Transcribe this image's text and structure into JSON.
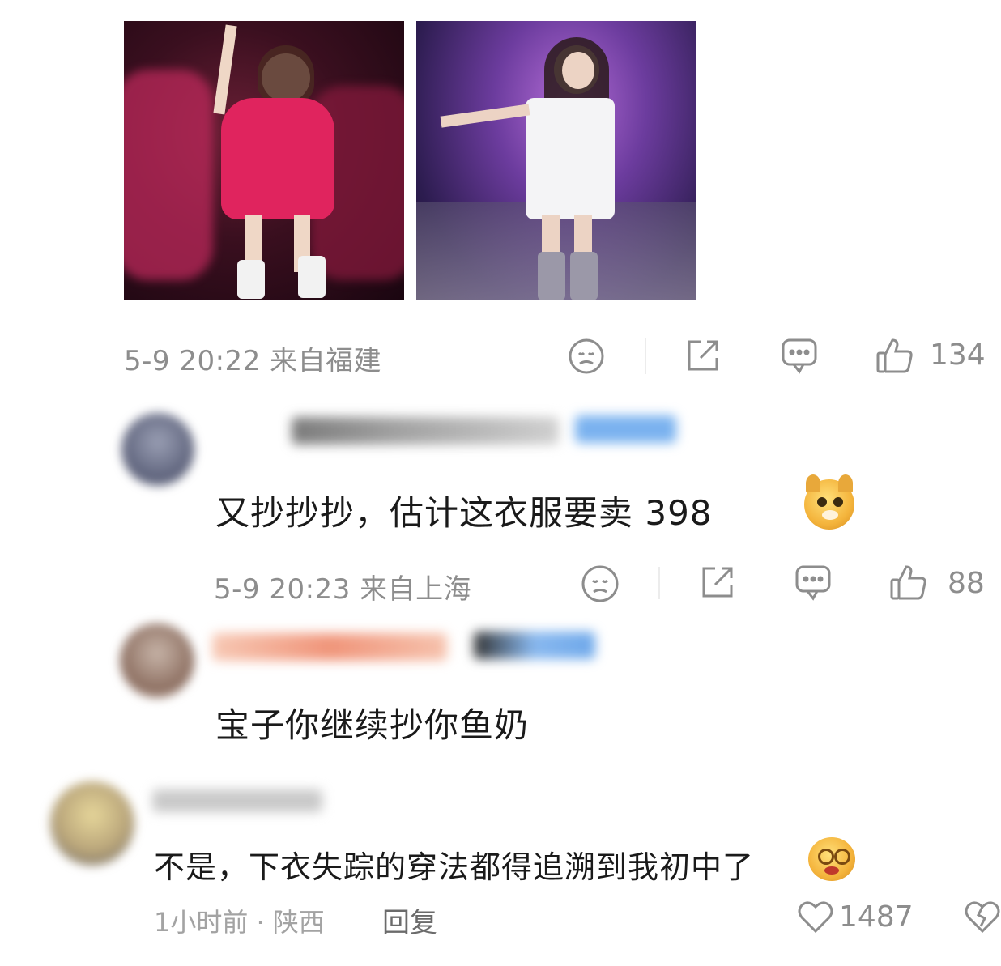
{
  "post": {
    "images": [
      {
        "name": "concert-photo-pink-shirt"
      },
      {
        "name": "concert-photo-white-shirt"
      }
    ],
    "meta": "5-9 20:22 来自福建",
    "like_count": "134"
  },
  "comments": [
    {
      "text": "又抄抄抄，估计这衣服要卖 398",
      "emoji": "doge-emoji",
      "meta": "5-9 20:23 来自上海",
      "like_count": "88"
    },
    {
      "text": "宝子你继续抄你鱼奶"
    },
    {
      "text": "不是，下衣失踪的穿法都得追溯到我初中了",
      "emoji": "dizzy-face-emoji",
      "time": "1小时前",
      "separator": "·",
      "location": "陕西",
      "reply_label": "回复",
      "like_count": "1487"
    }
  ],
  "colors": {
    "meta_gray": "#8d8d8d",
    "text_dark": "#1a1a1a",
    "accent_blue": "#4a90e2"
  }
}
